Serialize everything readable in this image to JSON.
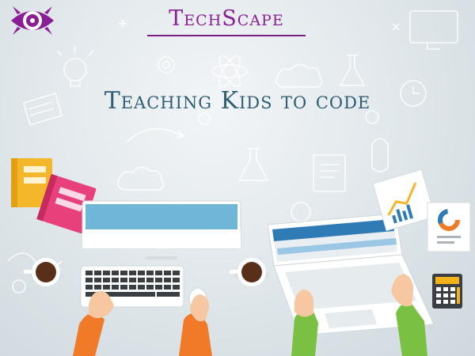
{
  "brand": {
    "title": "TechScape"
  },
  "headline": {
    "text": "Teaching Kids to code"
  },
  "colors": {
    "brand": "#8a1e95",
    "headline": "#2f5e73",
    "monitor_screen": "#6fb6d8",
    "laptop_screen": "#2f7bb6",
    "left_sleeve": "#f07a28",
    "right_sleeve": "#7ac143",
    "book_yellow": "#f4b62a",
    "book_pink": "#e8407a",
    "calculator": "#f2b21b"
  },
  "icons": {
    "logo": "eye-gear-logo",
    "computer": "desktop-monitor-icon",
    "keyboard": "keyboard-icon",
    "mouse": "mouse-icon",
    "laptop": "laptop-icon",
    "coffee": "coffee-cup-icon",
    "books": "books-icon",
    "report": "chart-report-icon",
    "calculator": "calculator-icon"
  }
}
